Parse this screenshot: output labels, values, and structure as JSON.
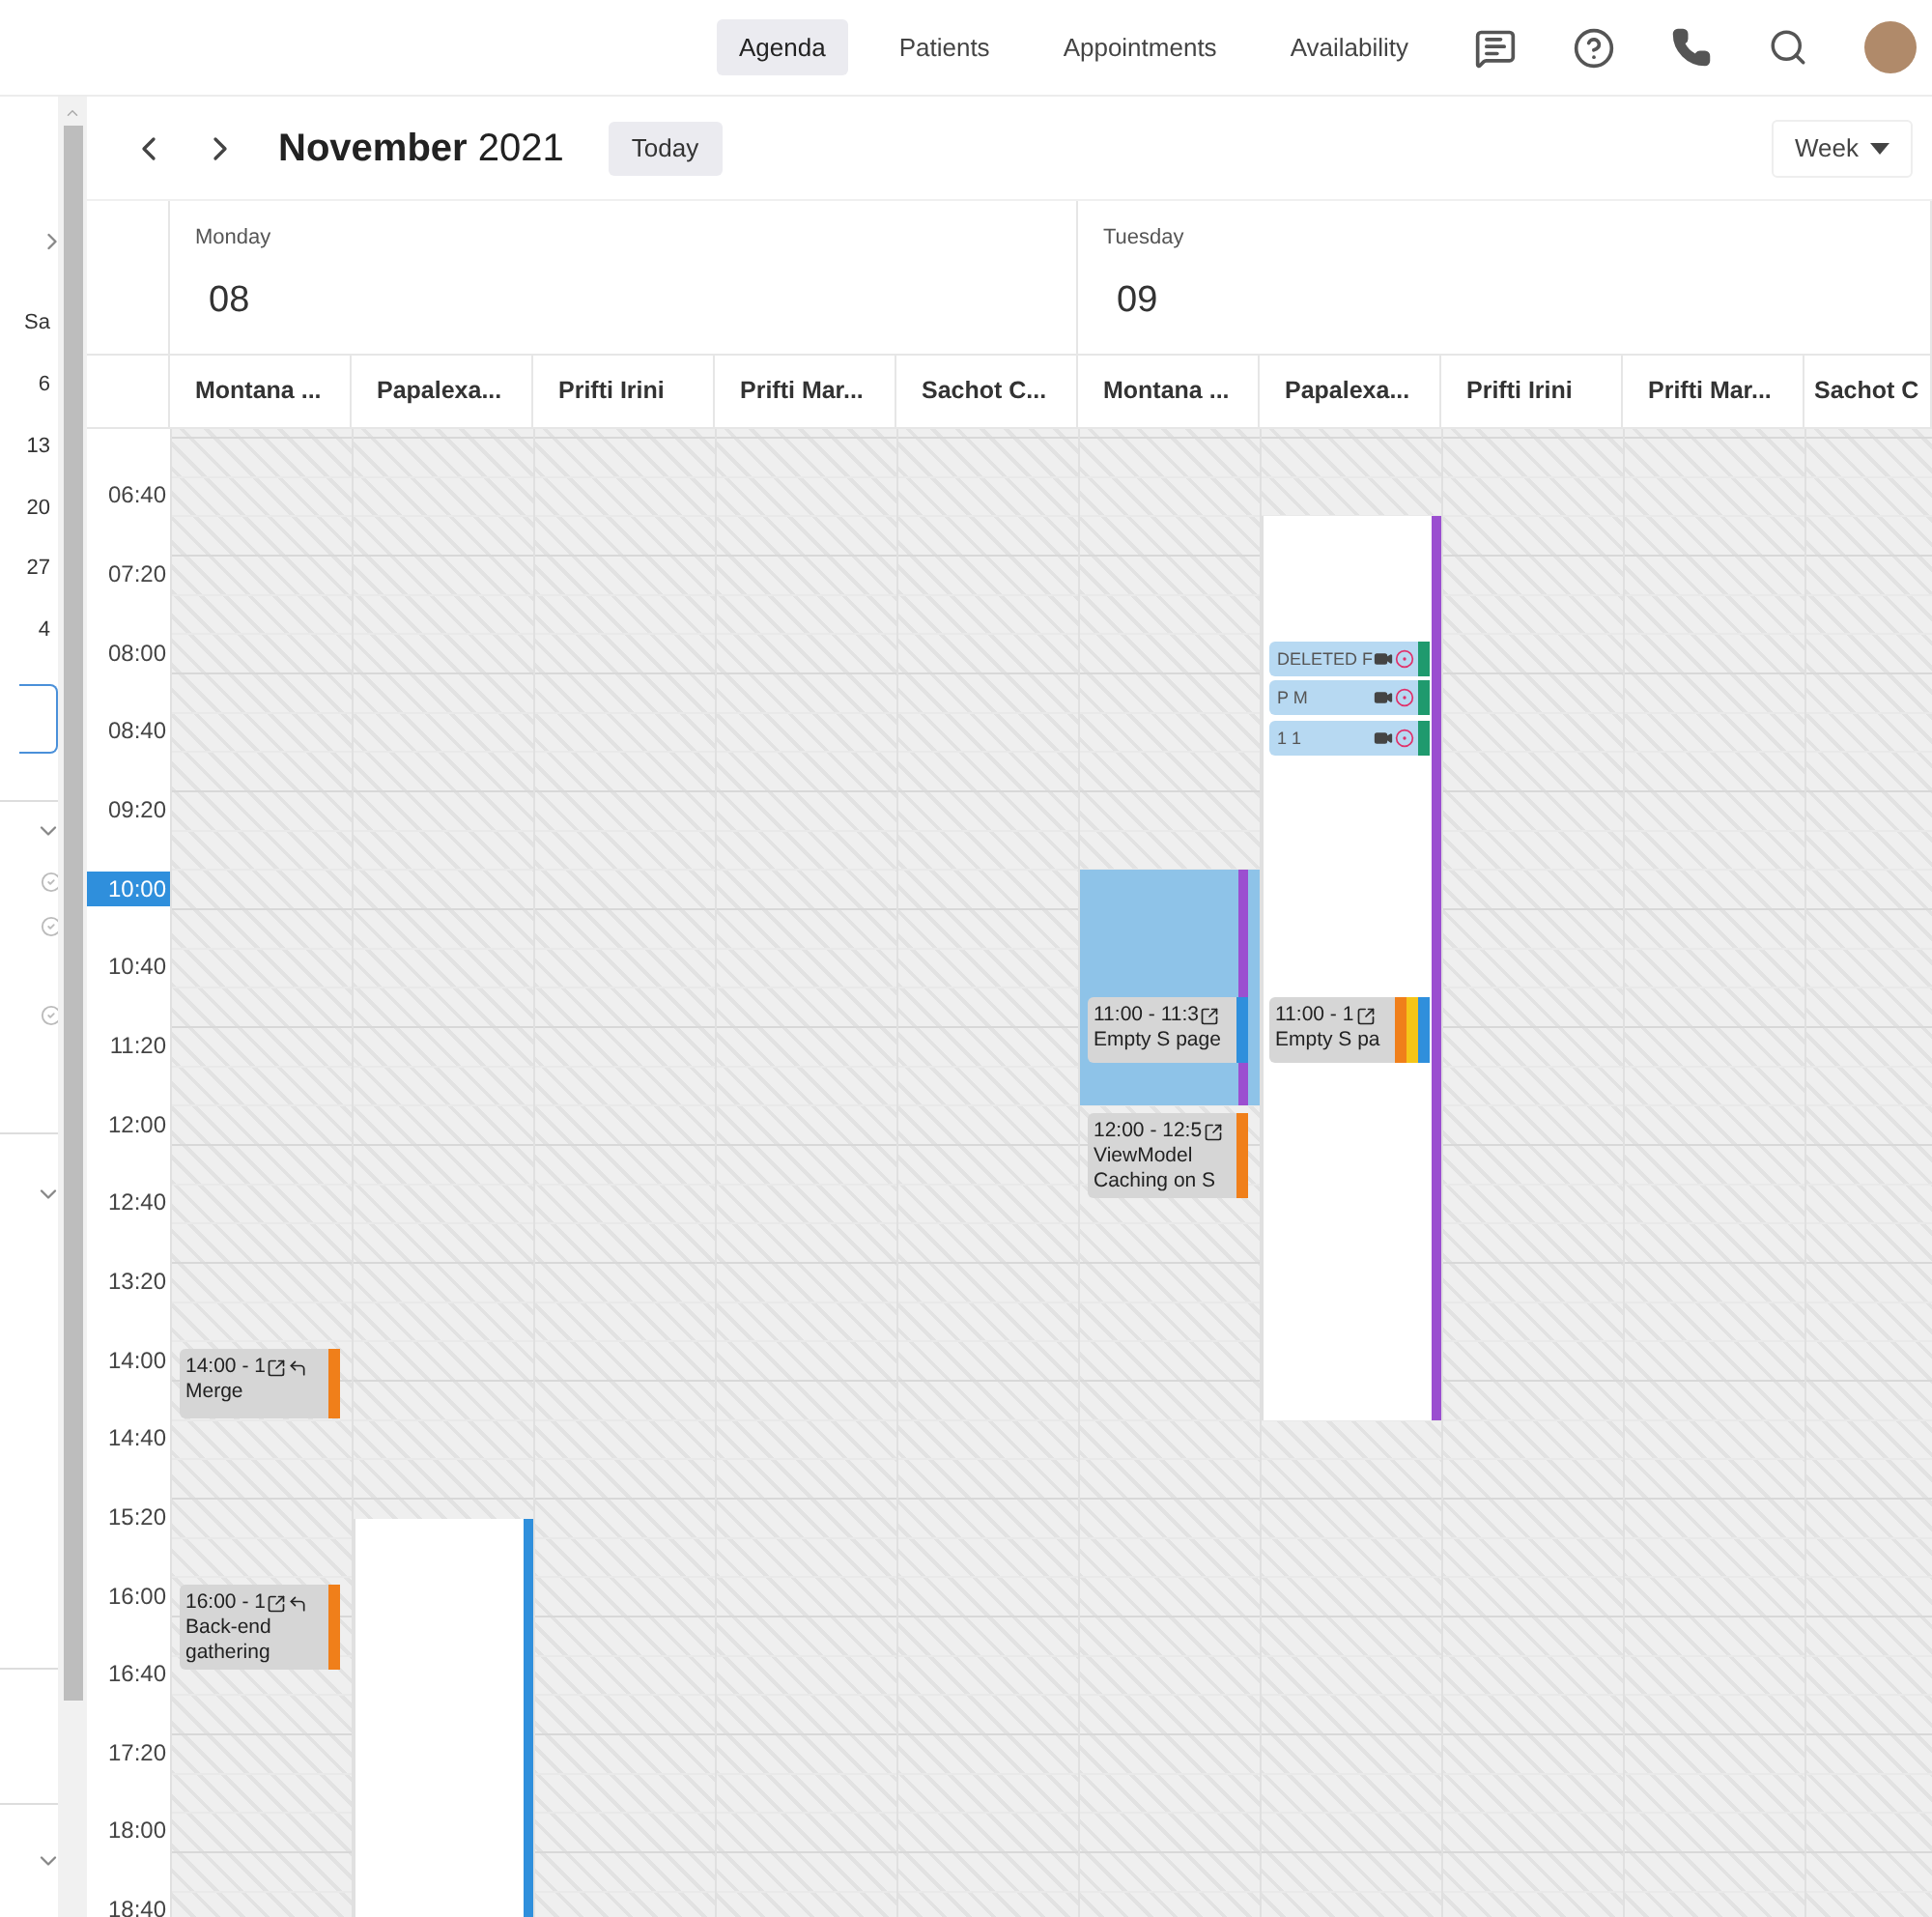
{
  "nav": {
    "tabs": [
      {
        "label": "Agenda",
        "selected": true
      },
      {
        "label": "Patients",
        "selected": false
      },
      {
        "label": "Appointments",
        "selected": false
      },
      {
        "label": "Availability",
        "selected": false
      }
    ]
  },
  "sidebar": {
    "mini_calendar": [
      "Sa",
      "6",
      "13",
      "20",
      "27",
      "4"
    ]
  },
  "toolbar": {
    "month": "November",
    "year": "2021",
    "today_button": "Today",
    "view_select": "Week"
  },
  "time_labels": [
    {
      "label": "06:40",
      "selected": false
    },
    {
      "label": "07:20",
      "selected": false
    },
    {
      "label": "08:00",
      "selected": false
    },
    {
      "label": "08:40",
      "selected": false
    },
    {
      "label": "09:20",
      "selected": false
    },
    {
      "label": "10:00",
      "selected": true
    },
    {
      "label": "10:40",
      "selected": false
    },
    {
      "label": "11:20",
      "selected": false
    },
    {
      "label": "12:00",
      "selected": false
    },
    {
      "label": "12:40",
      "selected": false
    },
    {
      "label": "13:20",
      "selected": false
    },
    {
      "label": "14:00",
      "selected": false
    },
    {
      "label": "14:40",
      "selected": false
    },
    {
      "label": "15:20",
      "selected": false
    },
    {
      "label": "16:00",
      "selected": false
    },
    {
      "label": "16:40",
      "selected": false
    },
    {
      "label": "17:20",
      "selected": false
    },
    {
      "label": "18:00",
      "selected": false
    },
    {
      "label": "18:40",
      "selected": false
    }
  ],
  "days": [
    {
      "weekday": "Monday",
      "date": "08",
      "resources": [
        {
          "name": "Montana ...",
          "events": [
            {
              "kind": "event",
              "time": "14:00 - 1",
              "title": "Merge",
              "external_link": true,
              "reply_arrow": true,
              "tags": [
                {
                  "color": "#f07f1a"
                }
              ]
            },
            {
              "kind": "event",
              "time": "16:00 - 1",
              "title": "Back-end gathering",
              "external_link": true,
              "reply_arrow": true,
              "tags": [
                {
                  "color": "#f07f1a"
                }
              ]
            }
          ]
        },
        {
          "name": "Papalexa...",
          "blocks": [
            {
              "kind": "open",
              "color": "#2f8fdc"
            }
          ]
        },
        {
          "name": "Prifti Irini"
        },
        {
          "name": "Prifti Mar..."
        },
        {
          "name": "Sachot C..."
        }
      ]
    },
    {
      "weekday": "Tuesday",
      "date": "09",
      "resources": [
        {
          "name": "Montana ...",
          "blocks": [
            {
              "kind": "selection",
              "color": "#9b4fd0"
            }
          ],
          "events": [
            {
              "kind": "event",
              "time": "11:00 - 11:3",
              "title": "Empty S page",
              "external_link": true,
              "reply_arrow": false,
              "tags": [
                {
                  "color": "#2f8fdc"
                }
              ]
            },
            {
              "kind": "event",
              "time": "12:00 - 12:5",
              "title": "ViewModel Caching on S",
              "external_link": true,
              "reply_arrow": false,
              "tags": [
                {
                  "color": "#f07f1a"
                }
              ]
            }
          ]
        },
        {
          "name": "Papalexa...",
          "blocks": [
            {
              "kind": "open",
              "color": "#9b4fd0"
            }
          ],
          "events": [
            {
              "kind": "chip",
              "title": "DELETED F",
              "tags": [
                {
                  "color": "#1f9a6e"
                }
              ]
            },
            {
              "kind": "chip",
              "title": "P M",
              "tags": [
                {
                  "color": "#1f9a6e"
                }
              ]
            },
            {
              "kind": "chip",
              "title": "1 1",
              "tags": [
                {
                  "color": "#1f9a6e"
                }
              ]
            },
            {
              "kind": "event",
              "time": "11:00 - 1",
              "title": "Empty S pa",
              "external_link": true,
              "reply_arrow": false,
              "tags": [
                {
                  "color": "#f07f1a"
                },
                {
                  "color": "#f5c518"
                },
                {
                  "color": "#2f8fdc"
                }
              ]
            }
          ]
        },
        {
          "name": "Prifti Irini"
        },
        {
          "name": "Prifti Mar..."
        },
        {
          "name": "Sachot C"
        }
      ]
    }
  ]
}
